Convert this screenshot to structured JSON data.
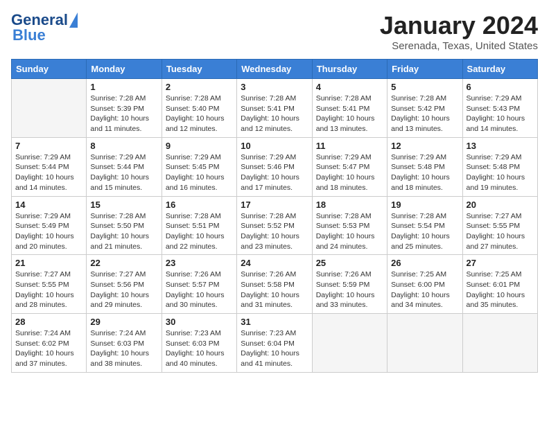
{
  "logo": {
    "line1": "General",
    "line2": "Blue"
  },
  "title": "January 2024",
  "subtitle": "Serenada, Texas, United States",
  "headers": [
    "Sunday",
    "Monday",
    "Tuesday",
    "Wednesday",
    "Thursday",
    "Friday",
    "Saturday"
  ],
  "weeks": [
    [
      {
        "day": "",
        "info": ""
      },
      {
        "day": "1",
        "info": "Sunrise: 7:28 AM\nSunset: 5:39 PM\nDaylight: 10 hours\nand 11 minutes."
      },
      {
        "day": "2",
        "info": "Sunrise: 7:28 AM\nSunset: 5:40 PM\nDaylight: 10 hours\nand 12 minutes."
      },
      {
        "day": "3",
        "info": "Sunrise: 7:28 AM\nSunset: 5:41 PM\nDaylight: 10 hours\nand 12 minutes."
      },
      {
        "day": "4",
        "info": "Sunrise: 7:28 AM\nSunset: 5:41 PM\nDaylight: 10 hours\nand 13 minutes."
      },
      {
        "day": "5",
        "info": "Sunrise: 7:28 AM\nSunset: 5:42 PM\nDaylight: 10 hours\nand 13 minutes."
      },
      {
        "day": "6",
        "info": "Sunrise: 7:29 AM\nSunset: 5:43 PM\nDaylight: 10 hours\nand 14 minutes."
      }
    ],
    [
      {
        "day": "7",
        "info": "Sunrise: 7:29 AM\nSunset: 5:44 PM\nDaylight: 10 hours\nand 14 minutes."
      },
      {
        "day": "8",
        "info": "Sunrise: 7:29 AM\nSunset: 5:44 PM\nDaylight: 10 hours\nand 15 minutes."
      },
      {
        "day": "9",
        "info": "Sunrise: 7:29 AM\nSunset: 5:45 PM\nDaylight: 10 hours\nand 16 minutes."
      },
      {
        "day": "10",
        "info": "Sunrise: 7:29 AM\nSunset: 5:46 PM\nDaylight: 10 hours\nand 17 minutes."
      },
      {
        "day": "11",
        "info": "Sunrise: 7:29 AM\nSunset: 5:47 PM\nDaylight: 10 hours\nand 18 minutes."
      },
      {
        "day": "12",
        "info": "Sunrise: 7:29 AM\nSunset: 5:48 PM\nDaylight: 10 hours\nand 18 minutes."
      },
      {
        "day": "13",
        "info": "Sunrise: 7:29 AM\nSunset: 5:48 PM\nDaylight: 10 hours\nand 19 minutes."
      }
    ],
    [
      {
        "day": "14",
        "info": "Sunrise: 7:29 AM\nSunset: 5:49 PM\nDaylight: 10 hours\nand 20 minutes."
      },
      {
        "day": "15",
        "info": "Sunrise: 7:28 AM\nSunset: 5:50 PM\nDaylight: 10 hours\nand 21 minutes."
      },
      {
        "day": "16",
        "info": "Sunrise: 7:28 AM\nSunset: 5:51 PM\nDaylight: 10 hours\nand 22 minutes."
      },
      {
        "day": "17",
        "info": "Sunrise: 7:28 AM\nSunset: 5:52 PM\nDaylight: 10 hours\nand 23 minutes."
      },
      {
        "day": "18",
        "info": "Sunrise: 7:28 AM\nSunset: 5:53 PM\nDaylight: 10 hours\nand 24 minutes."
      },
      {
        "day": "19",
        "info": "Sunrise: 7:28 AM\nSunset: 5:54 PM\nDaylight: 10 hours\nand 25 minutes."
      },
      {
        "day": "20",
        "info": "Sunrise: 7:27 AM\nSunset: 5:55 PM\nDaylight: 10 hours\nand 27 minutes."
      }
    ],
    [
      {
        "day": "21",
        "info": "Sunrise: 7:27 AM\nSunset: 5:55 PM\nDaylight: 10 hours\nand 28 minutes."
      },
      {
        "day": "22",
        "info": "Sunrise: 7:27 AM\nSunset: 5:56 PM\nDaylight: 10 hours\nand 29 minutes."
      },
      {
        "day": "23",
        "info": "Sunrise: 7:26 AM\nSunset: 5:57 PM\nDaylight: 10 hours\nand 30 minutes."
      },
      {
        "day": "24",
        "info": "Sunrise: 7:26 AM\nSunset: 5:58 PM\nDaylight: 10 hours\nand 31 minutes."
      },
      {
        "day": "25",
        "info": "Sunrise: 7:26 AM\nSunset: 5:59 PM\nDaylight: 10 hours\nand 33 minutes."
      },
      {
        "day": "26",
        "info": "Sunrise: 7:25 AM\nSunset: 6:00 PM\nDaylight: 10 hours\nand 34 minutes."
      },
      {
        "day": "27",
        "info": "Sunrise: 7:25 AM\nSunset: 6:01 PM\nDaylight: 10 hours\nand 35 minutes."
      }
    ],
    [
      {
        "day": "28",
        "info": "Sunrise: 7:24 AM\nSunset: 6:02 PM\nDaylight: 10 hours\nand 37 minutes."
      },
      {
        "day": "29",
        "info": "Sunrise: 7:24 AM\nSunset: 6:03 PM\nDaylight: 10 hours\nand 38 minutes."
      },
      {
        "day": "30",
        "info": "Sunrise: 7:23 AM\nSunset: 6:03 PM\nDaylight: 10 hours\nand 40 minutes."
      },
      {
        "day": "31",
        "info": "Sunrise: 7:23 AM\nSunset: 6:04 PM\nDaylight: 10 hours\nand 41 minutes."
      },
      {
        "day": "",
        "info": ""
      },
      {
        "day": "",
        "info": ""
      },
      {
        "day": "",
        "info": ""
      }
    ]
  ]
}
